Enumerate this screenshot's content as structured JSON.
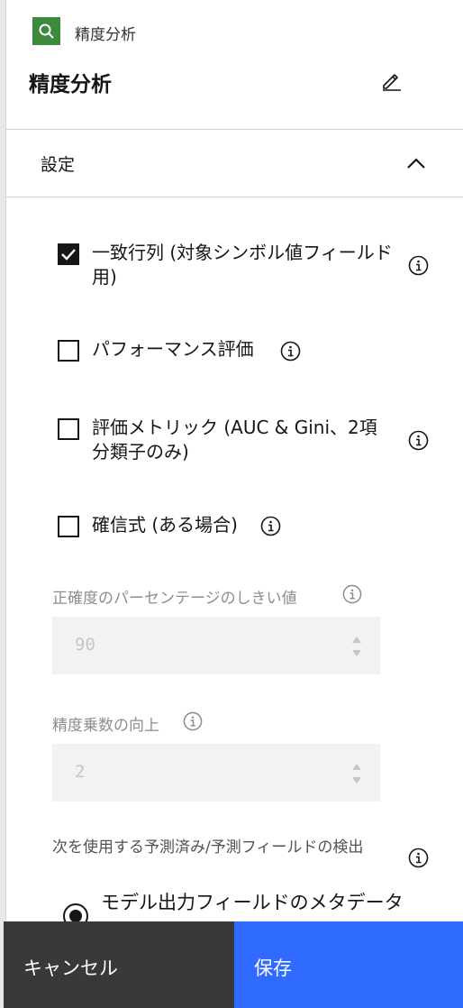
{
  "header": {
    "node_type": "精度分析",
    "title": "精度分析",
    "icon_color": "#3d8a3d"
  },
  "section": {
    "title": "設定",
    "expanded": true
  },
  "options": [
    {
      "label": "一致行列 (対象シンボル値フィールド用)",
      "checked": true
    },
    {
      "label": "パフォーマンス評価",
      "checked": false
    },
    {
      "label": "評価メトリック (AUC & Gini、2項分類子のみ)",
      "checked": false
    },
    {
      "label": "確信式 (ある場合)",
      "checked": false
    }
  ],
  "fields": {
    "threshold": {
      "label": "正確度のパーセンテージのしきい値",
      "value": "90"
    },
    "improve": {
      "label": "精度乗数の向上",
      "value": "2"
    }
  },
  "detect": {
    "label": "次を使用する予測済み/予測フィールドの検出",
    "radio_label": "モデル出力フィールドのメタデータ"
  },
  "footer": {
    "cancel_label": "キャンセル",
    "save_label": "保存",
    "cancel_color": "#393939",
    "save_color": "#2f6bff"
  }
}
